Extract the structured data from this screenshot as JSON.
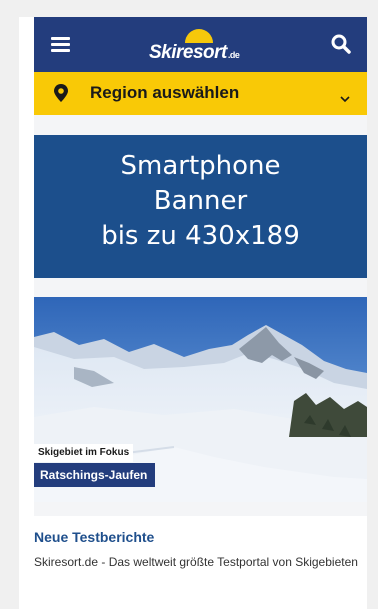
{
  "header": {
    "logo_text": "Skiresort",
    "logo_tld": ".de",
    "menu_icon": "hamburger-menu-icon",
    "search_icon": "search-icon"
  },
  "region": {
    "label": "Region auswählen",
    "pin_icon": "map-pin-icon",
    "chevron_icon": "chevron-down-icon"
  },
  "ad": {
    "line1": "Smartphone",
    "line2": "Banner",
    "line3": "bis zu 430x189"
  },
  "feature": {
    "tag": "Skigebiet im Fokus",
    "name": "Ratschings-Jaufen"
  },
  "news": {
    "title": "Neue Testberichte",
    "description": "Skiresort.de - Das weltweit größte Testportal von Skigebieten"
  },
  "colors": {
    "header_bg": "#233d7d",
    "region_bg": "#f9c906",
    "ad_bg": "#1c4f8c",
    "title_blue": "#1f4f8c"
  }
}
